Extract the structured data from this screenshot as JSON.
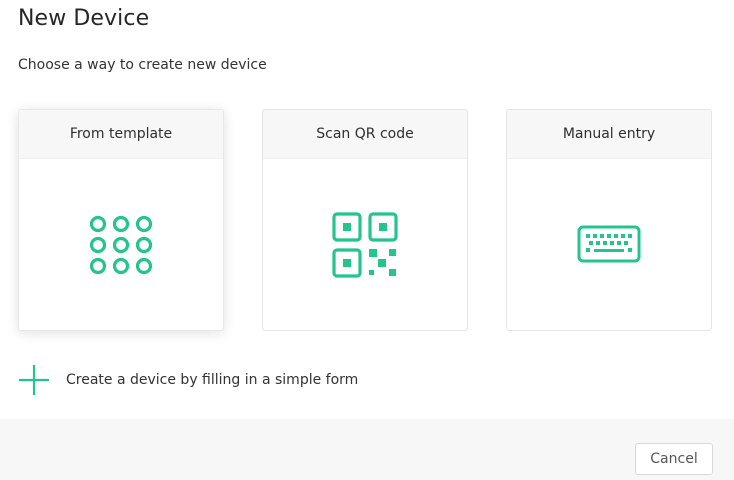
{
  "dialog": {
    "title": "New Device",
    "subtitle": "Choose a way to create new device"
  },
  "options": [
    {
      "label": "From template",
      "icon": "grid-dots-icon",
      "selected": true
    },
    {
      "label": "Scan QR code",
      "icon": "qr-code-icon",
      "selected": false
    },
    {
      "label": "Manual entry",
      "icon": "keyboard-icon",
      "selected": false
    }
  ],
  "create_link": {
    "label": "Create a device by filling in a simple form",
    "icon": "plus-icon"
  },
  "footer": {
    "cancel_label": "Cancel"
  },
  "colors": {
    "accent": "#23c48e",
    "card_header_bg": "#f7f7f7",
    "footer_bg": "#f7f7f7"
  }
}
